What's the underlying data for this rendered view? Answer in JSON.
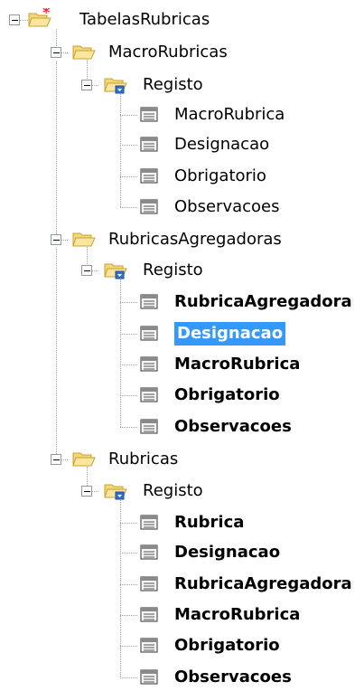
{
  "tree": {
    "root": {
      "label": "TabelasRubricas",
      "icon": "folder-new-icon",
      "expanded": true
    },
    "tables": [
      {
        "label": "MacroRubricas",
        "icon": "folder-icon",
        "expanded": true,
        "record": {
          "label": "Registo",
          "icon": "folder-record-icon",
          "expanded": true,
          "fields": [
            {
              "label": "MacroRubrica",
              "bold": false
            },
            {
              "label": "Designacao",
              "bold": false
            },
            {
              "label": "Obrigatorio",
              "bold": false
            },
            {
              "label": "Observacoes",
              "bold": false
            }
          ]
        }
      },
      {
        "label": "RubricasAgregadoras",
        "icon": "folder-icon",
        "expanded": true,
        "record": {
          "label": "Registo",
          "icon": "folder-record-icon",
          "expanded": true,
          "fields": [
            {
              "label": "RubricaAgregadora",
              "bold": true
            },
            {
              "label": "Designacao",
              "bold": true,
              "selected": true
            },
            {
              "label": "MacroRubrica",
              "bold": true
            },
            {
              "label": "Obrigatorio",
              "bold": true
            },
            {
              "label": "Observacoes",
              "bold": true
            }
          ]
        }
      },
      {
        "label": "Rubricas",
        "icon": "folder-icon",
        "expanded": true,
        "record": {
          "label": "Registo",
          "icon": "folder-record-icon",
          "expanded": true,
          "fields": [
            {
              "label": "Rubrica",
              "bold": true
            },
            {
              "label": "Designacao",
              "bold": true
            },
            {
              "label": "RubricaAgregadora",
              "bold": true
            },
            {
              "label": "MacroRubrica",
              "bold": true
            },
            {
              "label": "Obrigatorio",
              "bold": true
            },
            {
              "label": "Observacoes",
              "bold": true
            }
          ]
        }
      }
    ]
  },
  "colors": {
    "selection": "#3399ff",
    "connector": "#a0a0a0",
    "expander_border": "#919b9c",
    "folder_fill": "#f5d77a",
    "folder_stroke": "#c8a030",
    "star": "#e23030",
    "record_marker": "#2f6fd0"
  }
}
